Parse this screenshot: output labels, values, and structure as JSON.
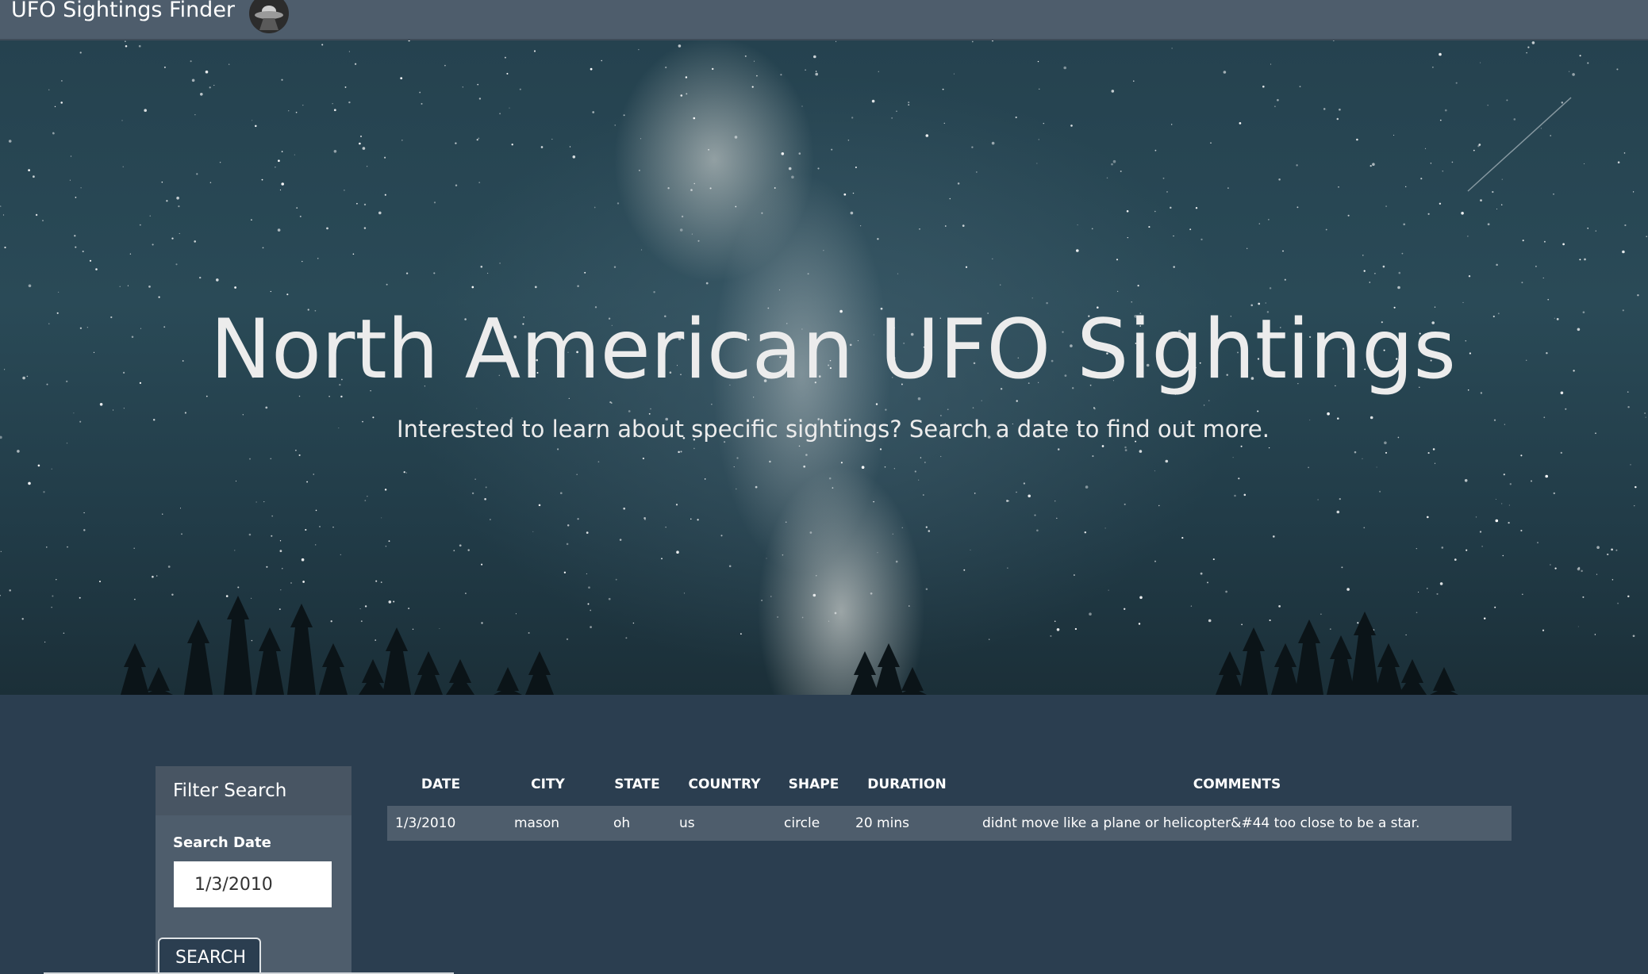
{
  "navbar": {
    "brand": "UFO Sightings Finder",
    "logo_icon": "ufo-logo-icon"
  },
  "hero": {
    "title": "North American UFO Sightings",
    "subtitle": "Interested to learn about specific sightings? Search a date to find out more."
  },
  "filter": {
    "heading": "Filter Search",
    "search_label": "Search Date",
    "search_value": "1/3/2010",
    "search_button": "SEARCH"
  },
  "table": {
    "headers": [
      "DATE",
      "CITY",
      "STATE",
      "COUNTRY",
      "SHAPE",
      "DURATION",
      "COMMENTS"
    ],
    "rows": [
      [
        "1/3/2010",
        "mason",
        "oh",
        "us",
        "circle",
        "20 mins",
        "didnt move like a plane or helicopter&#44 too close to be a star."
      ]
    ]
  },
  "colors": {
    "navbar": "#4e5d6c",
    "page_background": "#2b3e50",
    "panel": "#4e5d6c",
    "table_row": "#4e5d6c"
  }
}
